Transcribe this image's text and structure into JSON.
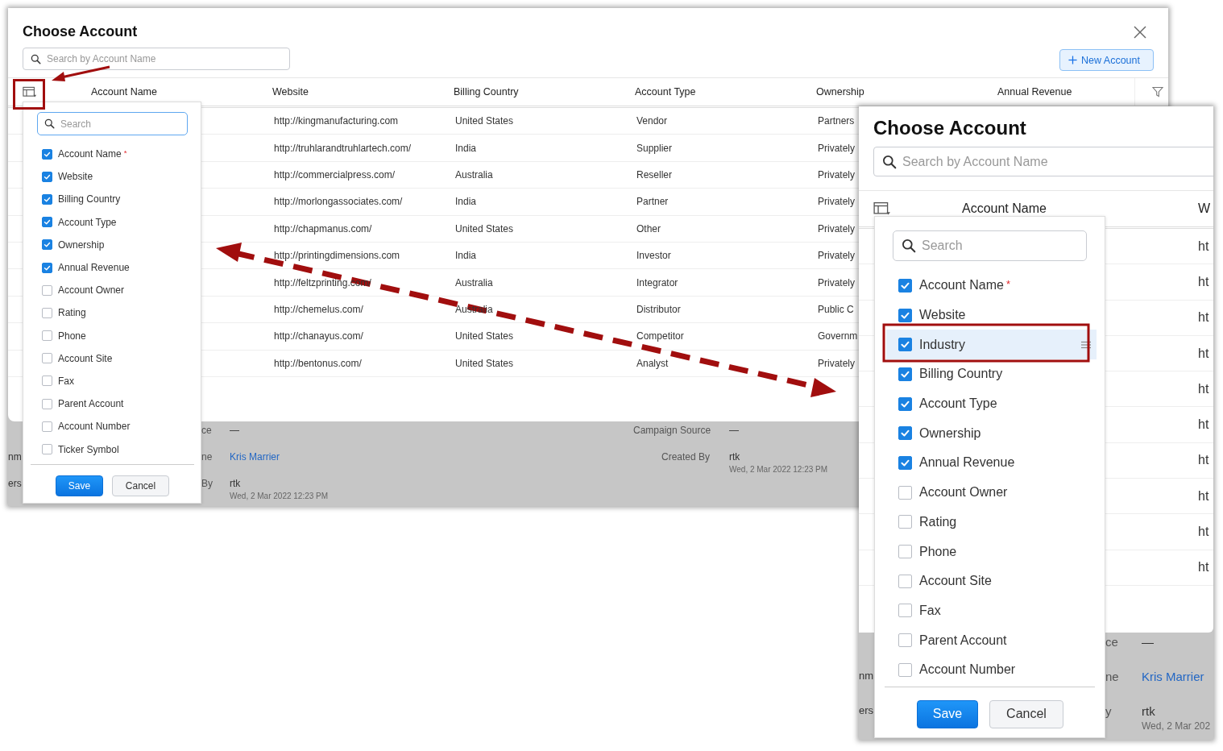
{
  "left_screenshot": {
    "dialog": {
      "title": "Choose Account",
      "search": {
        "placeholder": "Search by Account Name"
      },
      "new_account_button": "New Account",
      "columns": [
        {
          "label": "Account Name"
        },
        {
          "label": "Website"
        },
        {
          "label": "Billing Country"
        },
        {
          "label": "Account Type"
        },
        {
          "label": "Ownership"
        },
        {
          "label": "Annual Revenue"
        }
      ],
      "rows": [
        {
          "website": "http://kingmanufacturing.com",
          "billing_country": "United States",
          "account_type": "Vendor",
          "ownership": "Partners"
        },
        {
          "website": "http://truhlarandtruhlartech.com/",
          "billing_country": "India",
          "account_type": "Supplier",
          "ownership": "Privately"
        },
        {
          "website": "http://commercialpress.com/",
          "billing_country": "Australia",
          "account_type": "Reseller",
          "ownership": "Privately"
        },
        {
          "website": "http://morlongassociates.com/",
          "billing_country": "India",
          "account_type": "Partner",
          "ownership": "Privately"
        },
        {
          "website": "http://chapmanus.com/",
          "billing_country": "United States",
          "account_type": "Other",
          "ownership": "Privately"
        },
        {
          "website": "http://printingdimensions.com",
          "billing_country": "India",
          "account_type": "Investor",
          "ownership": "Privately"
        },
        {
          "website": "http://feltzprinting.com/",
          "billing_country": "Australia",
          "account_type": "Integrator",
          "ownership": "Privately"
        },
        {
          "website": "http://chemelus.com/",
          "billing_country": "Australia",
          "account_type": "Distributor",
          "ownership": "Public C"
        },
        {
          "website": "http://chanayus.com/",
          "billing_country": "United States",
          "account_type": "Competitor",
          "ownership": "Governm"
        },
        {
          "website": "http://bentonus.com/",
          "billing_country": "United States",
          "account_type": "Analyst",
          "ownership": "Privately"
        }
      ]
    },
    "record_page": {
      "rows": [
        {
          "label": "ce",
          "value": {
            "text": "—",
            "kind": "plain"
          },
          "label_2": "Campaign Source",
          "value_2": {
            "text": "—",
            "kind": "plain"
          }
        },
        {
          "left_edge": "nm",
          "label": "ne",
          "value": {
            "text": "Kris Marrier",
            "kind": "link"
          },
          "label_2": "Created By",
          "value_2": {
            "text": "rtk",
            "kind": "plain"
          },
          "detail_2": "Wed, 2 Mar 2022 12:23 PM"
        },
        {
          "left_edge": "ers",
          "label": "By",
          "value": {
            "text": "rtk",
            "kind": "plain"
          },
          "detail": "Wed, 2 Mar 2022 12:23 PM"
        }
      ]
    },
    "column_menu": {
      "search": {
        "placeholder": "Search"
      },
      "items": [
        {
          "label": "Account Name",
          "required_mark": "*",
          "checked": true
        },
        {
          "label": "Website",
          "checked": true
        },
        {
          "label": "Billing Country",
          "checked": true
        },
        {
          "label": "Account Type",
          "checked": true
        },
        {
          "label": "Ownership",
          "checked": true
        },
        {
          "label": "Annual Revenue",
          "checked": true
        },
        {
          "label": "Account Owner",
          "checked": false
        },
        {
          "label": "Rating",
          "checked": false
        },
        {
          "label": "Phone",
          "checked": false
        },
        {
          "label": "Account Site",
          "checked": false
        },
        {
          "label": "Fax",
          "checked": false
        },
        {
          "label": "Parent Account",
          "checked": false
        },
        {
          "label": "Account Number",
          "checked": false
        },
        {
          "label": "Ticker Symbol",
          "checked": false
        }
      ],
      "save_button": "Save",
      "cancel_button": "Cancel"
    }
  },
  "right_screenshot": {
    "dialog": {
      "title": "Choose Account",
      "search": {
        "placeholder": "Search by Account Name"
      },
      "columns": [
        {
          "label": "Account Name"
        },
        {
          "label": "W"
        }
      ],
      "rows": [
        {
          "website": "ht"
        },
        {
          "website": "ht"
        },
        {
          "website": "ht"
        },
        {
          "website": "ht"
        },
        {
          "website": "ht"
        },
        {
          "website": "ht"
        },
        {
          "website": "ht"
        },
        {
          "website": "ht"
        },
        {
          "website": "ht"
        },
        {
          "website": "ht"
        }
      ]
    },
    "record_page": {
      "rows": [
        {
          "label": "ce",
          "value": {
            "text": "—",
            "kind": "plain"
          }
        },
        {
          "left_edge": "nm",
          "label": "ne",
          "value": {
            "text": "Kris Marrier",
            "kind": "link"
          }
        },
        {
          "left_edge": "ers",
          "label": "y",
          "value": {
            "text": "rtk",
            "kind": "plain"
          },
          "detail": "Wed, 2 Mar 202"
        }
      ]
    },
    "column_menu": {
      "search": {
        "placeholder": "Search"
      },
      "items": [
        {
          "label": "Account Name",
          "required_mark": "*",
          "checked": true,
          "selected": false
        },
        {
          "label": "Website",
          "checked": true,
          "selected": false
        },
        {
          "label": "Industry",
          "checked": true,
          "selected": true
        },
        {
          "label": "Billing Country",
          "checked": true,
          "selected": false
        },
        {
          "label": "Account Type",
          "checked": true,
          "selected": false
        },
        {
          "label": "Ownership",
          "checked": true,
          "selected": false
        },
        {
          "label": "Annual Revenue",
          "checked": true,
          "selected": false
        },
        {
          "label": "Account Owner",
          "checked": false,
          "selected": false
        },
        {
          "label": "Rating",
          "checked": false,
          "selected": false
        },
        {
          "label": "Phone",
          "checked": false,
          "selected": false
        },
        {
          "label": "Account Site",
          "checked": false,
          "selected": false
        },
        {
          "label": "Fax",
          "checked": false,
          "selected": false
        },
        {
          "label": "Parent Account",
          "checked": false,
          "selected": false
        },
        {
          "label": "Account Number",
          "checked": false,
          "selected": false
        }
      ],
      "save_button": "Save",
      "cancel_button": "Cancel"
    }
  }
}
